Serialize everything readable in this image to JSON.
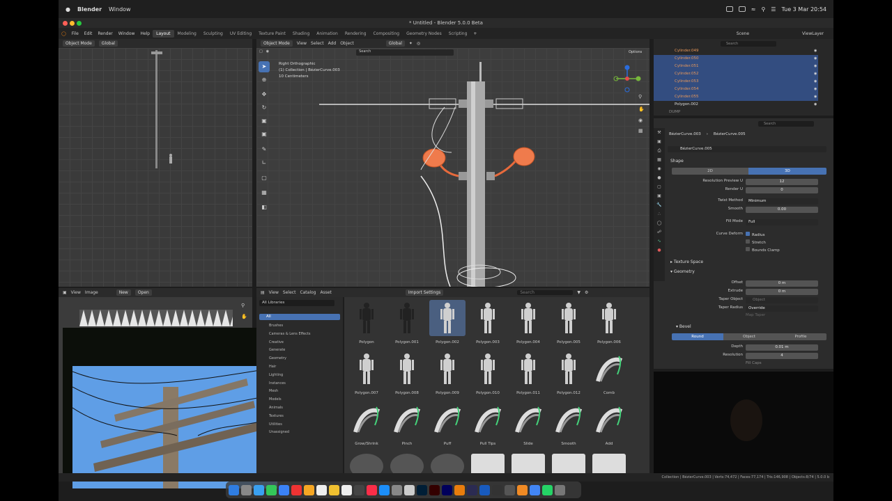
{
  "mac": {
    "app": "Blender",
    "menu": "Window",
    "datetime": "Tue 3 Mar  20:54"
  },
  "window": {
    "title": "* Untitled - Blender 5.0.0 Beta"
  },
  "menus": [
    "File",
    "Edit",
    "Render",
    "Window",
    "Help"
  ],
  "workspaces": [
    "Layout",
    "Modeling",
    "Sculpting",
    "UV Editing",
    "Texture Paint",
    "Shading",
    "Animation",
    "Rendering",
    "Compositing",
    "Geometry Nodes",
    "Scripting"
  ],
  "scene": {
    "scene_label": "Scene",
    "viewlayer_label": "ViewLayer"
  },
  "left_view": {
    "mode": "Object Mode",
    "orientation": "Global"
  },
  "viewport": {
    "mode": "Object Mode",
    "menu": [
      "View",
      "Select",
      "Add",
      "Object"
    ],
    "orientation": "Global",
    "options": "Options",
    "overlay": [
      "Right Orthographic",
      "(1) Collection | BézierCurve.003",
      "10 Centimeters"
    ],
    "search_placeholder": "Search"
  },
  "outliner": {
    "search_placeholder": "Search",
    "items": [
      {
        "name": "Cylinder.049",
        "selected": false
      },
      {
        "name": "Cylinder.050",
        "selected": true
      },
      {
        "name": "Cylinder.051",
        "selected": true
      },
      {
        "name": "Cylinder.052",
        "selected": true
      },
      {
        "name": "Cylinder.053",
        "selected": true
      },
      {
        "name": "Cylinder.054",
        "selected": true
      },
      {
        "name": "Cylinder.055",
        "selected": true
      },
      {
        "name": "Polygon.002",
        "selected": false
      },
      {
        "name": "DUMP",
        "selected": false
      }
    ]
  },
  "properties": {
    "search_placeholder": "Search",
    "breadcrumb": [
      "BézierCurve.003",
      "BézierCurve.005"
    ],
    "datablock": "BézierCurve.005",
    "shape_header": "Shape",
    "dim_2d": "2D",
    "dim_3d": "3D",
    "rows": [
      {
        "label": "Resolution Preview U",
        "value": "12"
      },
      {
        "label": "Render U",
        "value": "0"
      },
      {
        "label": "Twist Method",
        "value": "Minimum"
      },
      {
        "label": "Smooth",
        "value": "0.00"
      },
      {
        "label": "Fill Mode",
        "value": "Full"
      }
    ],
    "curve_deform": "Curve Deform",
    "checks": [
      {
        "label": "Radius",
        "checked": true
      },
      {
        "label": "Stretch",
        "checked": false
      },
      {
        "label": "Bounds Clamp",
        "checked": false
      }
    ],
    "texture_space": "Texture Space",
    "geometry_header": "Geometry",
    "geo_rows": [
      {
        "label": "Offset",
        "value": "0 m"
      },
      {
        "label": "Extrude",
        "value": "0 m"
      },
      {
        "label": "Taper Object",
        "value": "Object"
      },
      {
        "label": "Taper Radius",
        "value": "Override"
      }
    ],
    "map_taper": "Map Taper",
    "bevel_header": "Bevel",
    "bevel_tabs": [
      "Round",
      "Object",
      "Profile"
    ],
    "bevel_rows": [
      {
        "label": "Depth",
        "value": "0.01 m"
      },
      {
        "label": "Resolution",
        "value": "4"
      }
    ],
    "fill_caps": "Fill Caps"
  },
  "image_editor": {
    "menu": [
      "View",
      "Image"
    ],
    "new_label": "New",
    "open_label": "Open"
  },
  "asset_browser": {
    "menu": [
      "View",
      "Select",
      "Catalog",
      "Asset"
    ],
    "import_settings": "Import Settings",
    "library": "All Libraries",
    "catalog_all": "All",
    "catalogs": [
      "Brushes",
      "Cameras & Lens Effects",
      "Creative",
      "Generate",
      "Geometry",
      "Hair",
      "Lighting",
      "Instances",
      "Mesh",
      "Models",
      "Animals",
      "Textures",
      "Utilities",
      "Unassigned"
    ],
    "search_placeholder": "Search",
    "assets": [
      {
        "name": "Polygon",
        "kind": "figure-dark",
        "selected": false
      },
      {
        "name": "Polygon.001",
        "kind": "figure-dark",
        "selected": false
      },
      {
        "name": "Polygon.002",
        "kind": "figure",
        "selected": true
      },
      {
        "name": "Polygon.003",
        "kind": "figure",
        "selected": false
      },
      {
        "name": "Polygon.004",
        "kind": "figure",
        "selected": false
      },
      {
        "name": "Polygon.005",
        "kind": "figure",
        "selected": false
      },
      {
        "name": "Polygon.006",
        "kind": "figure",
        "selected": false
      },
      {
        "name": "Polygon.007",
        "kind": "figure",
        "selected": false
      },
      {
        "name": "Polygon.008",
        "kind": "figure",
        "selected": false
      },
      {
        "name": "Polygon.009",
        "kind": "figure",
        "selected": false
      },
      {
        "name": "Polygon.010",
        "kind": "figure",
        "selected": false
      },
      {
        "name": "Polygon.011",
        "kind": "figure",
        "selected": false
      },
      {
        "name": "Polygon.012",
        "kind": "figure",
        "selected": false
      },
      {
        "name": "Comb",
        "kind": "brush",
        "selected": false
      },
      {
        "name": "Grow/Shrink",
        "kind": "brush",
        "selected": false
      },
      {
        "name": "Pinch",
        "kind": "brush",
        "selected": false
      },
      {
        "name": "Puff",
        "kind": "brush",
        "selected": false
      },
      {
        "name": "Pull Tips",
        "kind": "brush",
        "selected": false
      },
      {
        "name": "Slide",
        "kind": "brush",
        "selected": false
      },
      {
        "name": "Smooth",
        "kind": "brush",
        "selected": false
      },
      {
        "name": "Add",
        "kind": "brush",
        "selected": false
      }
    ]
  },
  "statusbar": "Collection | BézierCurve.003 | Verts:74,472 | Faces:77,174 | Tris:146,908 | Objects:8/74 | 5.0.0 b",
  "colors": {
    "accent": "#4772b3",
    "selection": "#334d80",
    "object_orange": "#e9985a",
    "sky": "#5f9ee6"
  }
}
